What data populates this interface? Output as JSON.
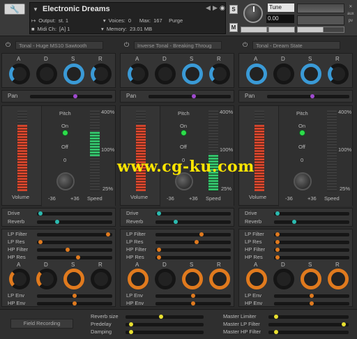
{
  "header": {
    "title": "Electronic Dreams",
    "output_label": "Output:",
    "output_value": "st. 1",
    "voices_label": "Voices:",
    "voices_value": "0",
    "max_label": "Max:",
    "max_value": "167",
    "purge_label": "Purge",
    "midi_label": "Midi Ch:",
    "midi_value": "[A]  1",
    "memory_label": "Memory:",
    "memory_value": "23.01 MB",
    "solo_label": "S",
    "mute_label": "M",
    "tune_label": "Tune",
    "tune_value": "0.00",
    "aux_label": "aux",
    "pv_label": "pv"
  },
  "columns": [
    {
      "slot": "Tonal - Huge MS10 Sawtooth"
    },
    {
      "slot": "Inverse Tonal - Breaking Throug"
    },
    {
      "slot": "Tonal - Dream State"
    }
  ],
  "labels": {
    "a": "A",
    "d": "D",
    "s": "S",
    "r": "R",
    "pan": "Pan",
    "pitch": "Pitch",
    "on": "On",
    "off": "Off",
    "zero": "0",
    "volume": "Volume",
    "speed": "Speed",
    "minus36": "-36",
    "plus36": "+36",
    "p400": "400%",
    "p100": "100%",
    "p25": "25%",
    "drive": "Drive",
    "reverb": "Reverb",
    "lpf": "LP Filter",
    "lpr": "LP Res",
    "hpf": "HP Filter",
    "hpr": "HP Res",
    "lpenv": "LP Env",
    "hpenv": "HP Env"
  },
  "footer": {
    "field_recording": "Field Recording",
    "reverb_size": "Reverb size",
    "predelay": "Predelay",
    "damping": "Damping",
    "master_limiter": "Master Limiter",
    "master_lp": "Master LP Filter",
    "master_hp": "Master HP Filter"
  },
  "watermark": "www.cg-ku.com",
  "colors": {
    "blue": "#3a9ad6",
    "orange": "#e07a1e",
    "purple": "#a04ad0",
    "teal": "#2bbbb0",
    "yellow": "#e8e030",
    "red": "#d3452c",
    "green": "#33c06a"
  }
}
